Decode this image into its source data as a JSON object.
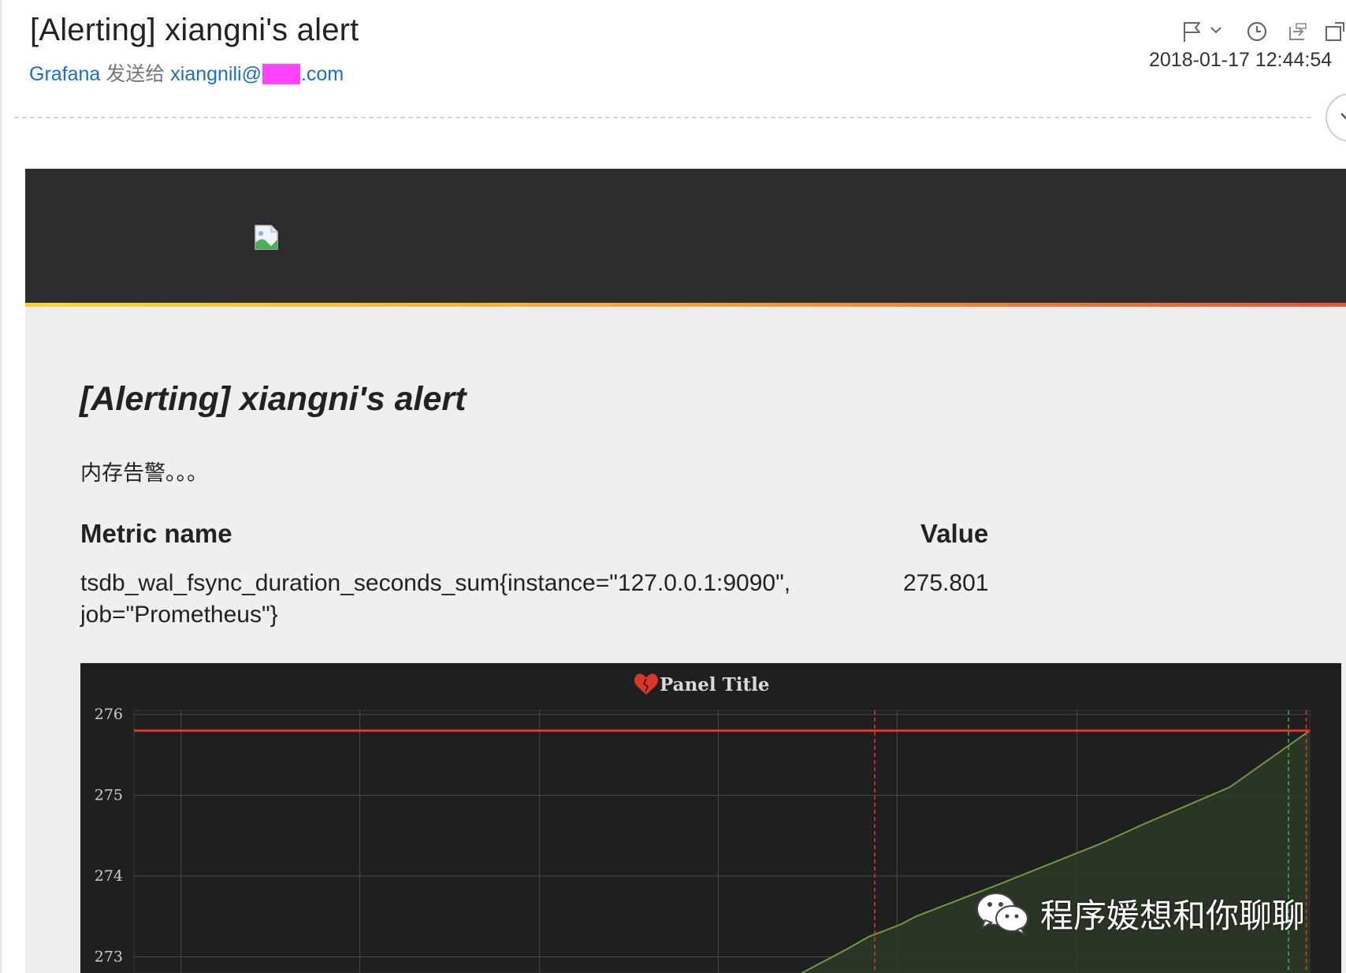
{
  "email": {
    "subject": "[Alerting] xiangni's alert",
    "sender": "Grafana",
    "sent_to_label": "发送给",
    "recipient_user": "xiangnili@",
    "recipient_domain": ".com",
    "date": "2018-01-17 12:44:54"
  },
  "body": {
    "title": "[Alerting] xiangni's alert",
    "message": "内存告警。。。",
    "table": {
      "headers": {
        "metric": "Metric name",
        "value": "Value"
      },
      "rows": [
        {
          "metric": "tsdb_wal_fsync_duration_seconds_sum{instance=\"127.0.0.1:9090\", job=\"Prometheus\"}",
          "value": "275.801"
        }
      ]
    }
  },
  "chart_data": {
    "type": "area",
    "title": "Panel Title",
    "ylim": [
      272.8,
      276.05
    ],
    "yticks": [
      "276",
      "275",
      "274",
      "273"
    ],
    "threshold": 275.8,
    "series": [
      {
        "x": [
          0.568,
          0.607,
          0.625,
          0.652,
          0.665,
          0.736,
          0.822,
          0.86,
          0.932,
          1.0
        ],
        "values": [
          272.8,
          273.1,
          273.25,
          273.4,
          273.5,
          273.9,
          274.4,
          274.65,
          275.1,
          275.8
        ]
      }
    ],
    "colors": {
      "threshold": "#e0342b",
      "series": "#6f9a45",
      "alert_marker": "#d8402f",
      "ok_marker": "#3fb34f"
    }
  },
  "watermark": {
    "text": "程序媛想和你聊聊"
  }
}
